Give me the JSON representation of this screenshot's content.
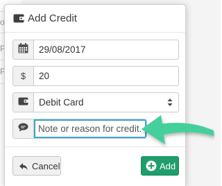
{
  "background": {
    "row_labels": [
      "o",
      "P",
      "P"
    ]
  },
  "modal": {
    "title": "Add Credit",
    "title_icon": "wallet-icon",
    "date_field": {
      "icon": "calendar-icon",
      "value": "29/08/2017"
    },
    "amount_field": {
      "addon": "$",
      "value": "20"
    },
    "payment_method": {
      "icon": "wallet-icon",
      "selected": "Debit Card",
      "caret": "sort-caret-icon"
    },
    "note_field": {
      "icon": "comment-icon",
      "placeholder": "Note or reason for credit.",
      "value": ""
    },
    "cancel_label": "Cancel",
    "add_label": "Add"
  },
  "colors": {
    "accent_focus": "#3ba8c9",
    "add_button": "#1f9d6b",
    "arrow": "#44cf9c"
  }
}
